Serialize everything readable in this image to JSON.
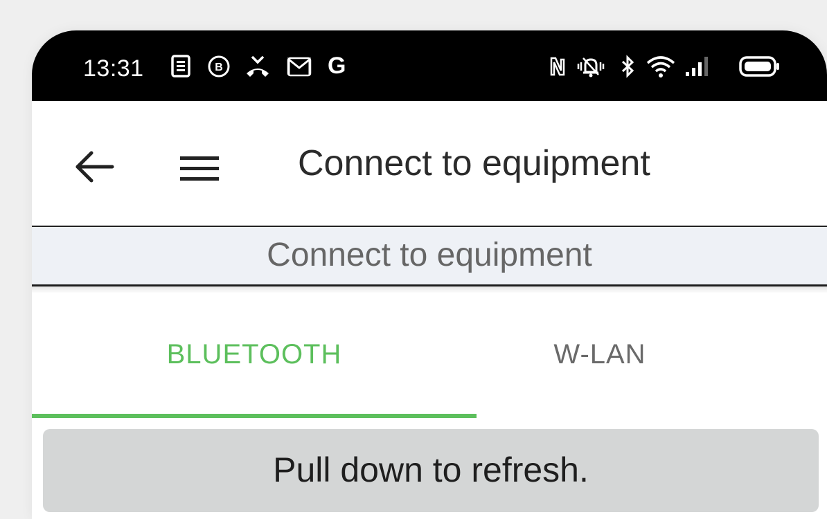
{
  "status_bar": {
    "time": "13:31",
    "google_glyph": "G",
    "icons_left": [
      "news-icon",
      "b-badge-icon",
      "missed-call-icon",
      "gmail-icon",
      "google-icon"
    ],
    "icons_right": [
      "nfc-icon",
      "vibrate-icon",
      "bluetooth-icon",
      "wifi-icon",
      "signal-icon",
      "battery-icon"
    ]
  },
  "app_bar": {
    "title": "Connect to equipment"
  },
  "sub_header": {
    "text": "Connect to equipment"
  },
  "tabs": [
    {
      "label": "BLUETOOTH",
      "selected": true
    },
    {
      "label": "W-LAN",
      "selected": false
    }
  ],
  "banner": {
    "text": "Pull down to refresh."
  },
  "colors": {
    "accent": "#5cbf5c",
    "status_bar_bg": "#000000",
    "sub_header_bg": "#eef1f6",
    "banner_bg": "#d4d6d6"
  }
}
